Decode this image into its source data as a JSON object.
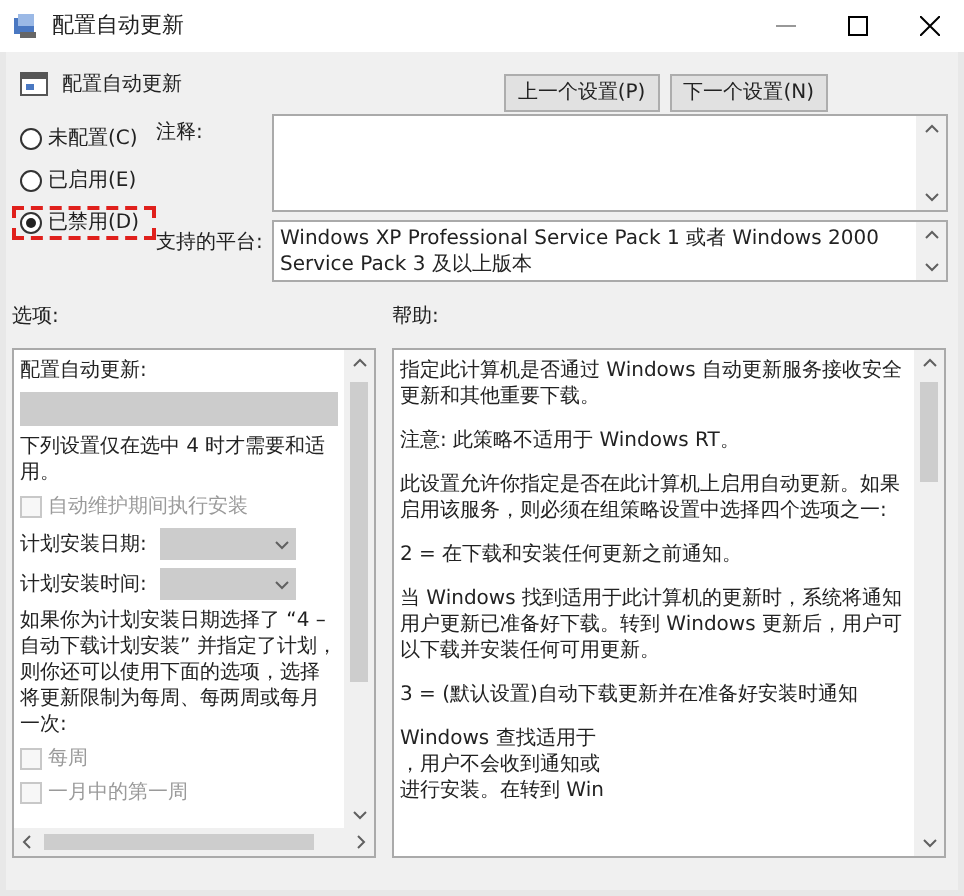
{
  "window": {
    "title": "配置自动更新"
  },
  "header": {
    "title": "配置自动更新",
    "buttons": [
      "上一个设置(P)",
      "下一个设置(N)"
    ]
  },
  "state_options": [
    {
      "label": "未配置(C)",
      "selected": false,
      "highlighted": false
    },
    {
      "label": "已启用(E)",
      "selected": false,
      "highlighted": false
    },
    {
      "label": "已禁用(D)",
      "selected": true,
      "highlighted": true
    }
  ],
  "comment": {
    "label": "注释:"
  },
  "platform": {
    "label": "支持的平台:",
    "value": "Windows XP Professional Service Pack 1 或者 Windows 2000 Service Pack 3 及以上版本"
  },
  "options_panel": {
    "label": "选项:",
    "items": [
      {
        "kind": "text",
        "text": "配置自动更新:"
      },
      {
        "kind": "select",
        "disabled": true
      },
      {
        "kind": "text",
        "text": "下列设置仅在选中 4 时才需要和适用。"
      },
      {
        "kind": "checkbox",
        "text": "自动维护期间执行安装",
        "checked": false,
        "disabled": true
      },
      {
        "kind": "dropdown",
        "text": "计划安装日期:",
        "disabled": true
      },
      {
        "kind": "dropdown",
        "text": "计划安装时间:",
        "disabled": true
      },
      {
        "kind": "text",
        "text": "如果你为计划安装日期选择了 “4 – 自动下载计划安装” 并指定了计划，则你还可以使用下面的选项，选择将更新限制为每周、每两周或每月一次:"
      },
      {
        "kind": "checkbox",
        "text": "每周",
        "checked": false,
        "disabled": true
      },
      {
        "kind": "checkbox",
        "text": "一月中的第一周",
        "checked": false,
        "disabled": true
      }
    ]
  },
  "help_panel": {
    "label": "帮助:",
    "paragraphs": [
      "指定此计算机是否通过 Windows 自动更新服务接收安全更新和其他重要下载。",
      "注意: 此策略不适用于 Windows RT。",
      "此设置允许你指定是否在此计算机上启用自动更新。如果启用该服务，则必须在组策略设置中选择四个选项之一:",
      " 2 = 在下载和安装任何更新之前通知。",
      " 当 Windows 找到适用于此计算机的更新时，系统将通知用户更新已准备好下载。转到 Windows 更新后，用户可以下载并安装任何可用更新。",
      " 3 = (默认设置)自动下载更新并在准备好安装时通知",
      "Windows 查找适用于",
      "，用户不会收到通知或",
      "进行安装。在转到 Win"
    ]
  }
}
